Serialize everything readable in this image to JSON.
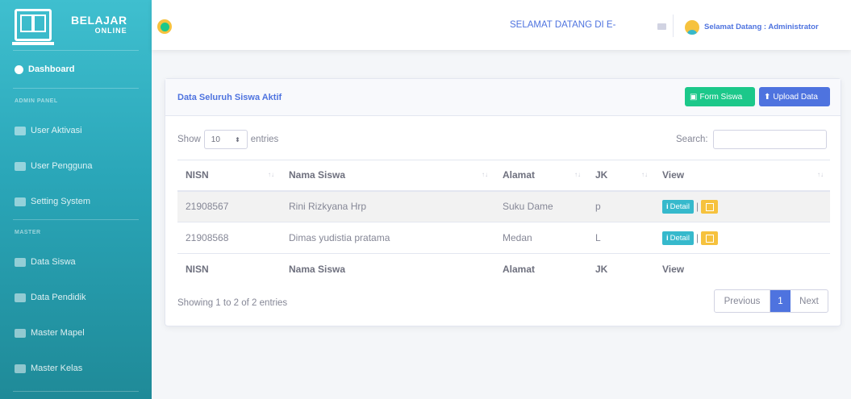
{
  "brand": {
    "line1": "BELAJAR",
    "line2": "ONLINE"
  },
  "sidebar": {
    "dashboard": "Dashboard",
    "heading_admin": "ADMIN PANEL",
    "admin_items": [
      "User Aktivasi",
      "User Pengguna",
      "Setting System"
    ],
    "heading_master": "MASTER",
    "master_items": [
      "Data Siswa",
      "Data Pendidik",
      "Master Mapel",
      "Master Kelas"
    ]
  },
  "topbar": {
    "welcome": "SELAMAT DATANG DI E-",
    "user": "Selamat Datang : Administrator"
  },
  "card": {
    "title": "Data Seluruh Siswa Aktif",
    "form_button": "Form Siswa",
    "upload_button": "Upload Data",
    "show_label": "Show",
    "entries_value": "10",
    "entries_label": "entries",
    "search_label": "Search:",
    "columns": [
      "NISN",
      "Nama Siswa",
      "Alamat",
      "JK",
      "View"
    ],
    "rows": [
      {
        "nisn": "21908567",
        "nama": "Rini Rizkyana Hrp",
        "alamat": "Suku Dame",
        "jk": "p"
      },
      {
        "nisn": "21908568",
        "nama": "Dimas yudistia pratama",
        "alamat": "Medan",
        "jk": "L"
      }
    ],
    "detail_label": "Detail",
    "info": "Showing 1 to 2 of 2 entries",
    "pagination": {
      "previous": "Previous",
      "page": "1",
      "next": "Next"
    }
  },
  "colors": {
    "sidebar": "#36b9cc",
    "primary": "#4e73df",
    "success": "#1cc88a",
    "warning": "#f6c23e"
  }
}
